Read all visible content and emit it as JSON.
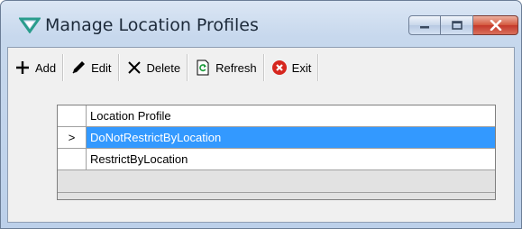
{
  "window": {
    "title": "Manage Location Profiles",
    "accent_color": "#2a9c8c"
  },
  "toolbar": {
    "add_label": "Add",
    "edit_label": "Edit",
    "delete_label": "Delete",
    "refresh_label": "Refresh",
    "exit_label": "Exit"
  },
  "grid": {
    "column_header": "Location Profile",
    "current_row_marker": ">",
    "rows": [
      {
        "value": "DoNotRestrictByLocation",
        "selected": true
      },
      {
        "value": "RestrictByLocation",
        "selected": false
      }
    ],
    "selection_color": "#3399ff"
  }
}
